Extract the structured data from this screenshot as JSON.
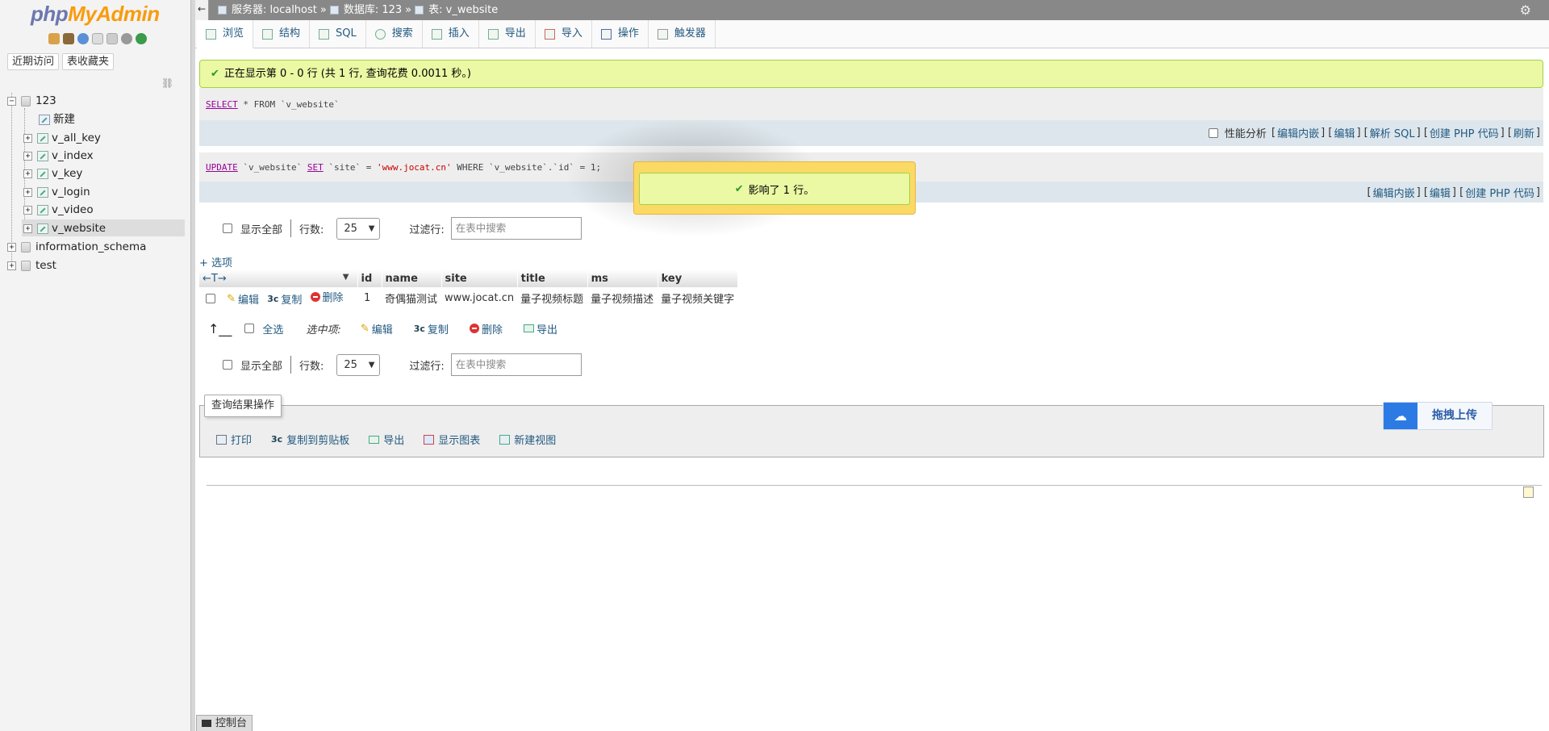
{
  "sidebar": {
    "logo_php": "php",
    "logo_my": "MyAdmin",
    "recent_label": "近期访问",
    "favorites_label": "表收藏夹",
    "tree": [
      {
        "label": "123",
        "type": "db",
        "expanded": true
      },
      {
        "label": "新建",
        "type": "new"
      },
      {
        "label": "v_all_key",
        "type": "table"
      },
      {
        "label": "v_index",
        "type": "table"
      },
      {
        "label": "v_key",
        "type": "table"
      },
      {
        "label": "v_login",
        "type": "table"
      },
      {
        "label": "v_video",
        "type": "table"
      },
      {
        "label": "v_website",
        "type": "table",
        "selected": true
      },
      {
        "label": "information_schema",
        "type": "db"
      },
      {
        "label": "test",
        "type": "db"
      }
    ]
  },
  "topbar": {
    "server": "服务器: localhost",
    "database": "数据库: 123",
    "table": "表: v_website",
    "sep": "»"
  },
  "tabs": [
    {
      "label": "浏览",
      "active": true
    },
    {
      "label": "结构"
    },
    {
      "label": "SQL"
    },
    {
      "label": "搜索"
    },
    {
      "label": "插入"
    },
    {
      "label": "导出"
    },
    {
      "label": "导入"
    },
    {
      "label": "操作"
    },
    {
      "label": "触发器"
    }
  ],
  "success_message": "正在显示第 0 - 0 行 (共 1 行, 查询花费 0.0011 秒。)",
  "select_query": {
    "kw": "SELECT",
    "rest": " * FROM `v_website`"
  },
  "select_links": {
    "profiling": "性能分析",
    "inline_edit": "编辑内嵌",
    "edit": "编辑",
    "explain": "解析 SQL",
    "create_php": "创建 PHP 代码",
    "refresh": "刷新"
  },
  "update_query": {
    "kw1": "UPDATE",
    "p1": " `v_website` ",
    "kw2": "SET",
    "p2": " `site` = ",
    "str": "'www.jocat.cn'",
    "p3": " WHERE `v_website`.`id` = 1;"
  },
  "update_links": {
    "inline_edit": "编辑内嵌",
    "edit": "编辑",
    "create_php": "创建 PHP 代码"
  },
  "toast_message": "影响了 1 行。",
  "nav": {
    "show_all": "显示全部",
    "rows_label": "行数:",
    "rows_value": "25",
    "filter_label": "过滤行:",
    "filter_placeholder": "在表中搜索"
  },
  "options_link": "+ 选项",
  "table": {
    "columns": [
      "id",
      "name",
      "site",
      "title",
      "ms",
      "key"
    ],
    "actions": {
      "edit": "编辑",
      "copy": "复制",
      "delete": "删除"
    },
    "rows": [
      {
        "id": "1",
        "name": "奇偶猫测试",
        "site": "www.jocat.cn",
        "title": "量子视频标题",
        "ms": "量子视频描述",
        "key": "量子视频关键字"
      }
    ]
  },
  "bulk": {
    "select_all": "全选",
    "with_selected": "选中项:",
    "edit": "编辑",
    "copy": "复制",
    "delete": "删除",
    "export": "导出"
  },
  "query_ops": {
    "legend": "查询结果操作",
    "print": "打印",
    "copy_clipboard": "复制到剪贴板",
    "export": "导出",
    "chart": "显示图表",
    "create_view": "新建视图"
  },
  "upload_label": "拖拽上传",
  "console_label": "控制台"
}
